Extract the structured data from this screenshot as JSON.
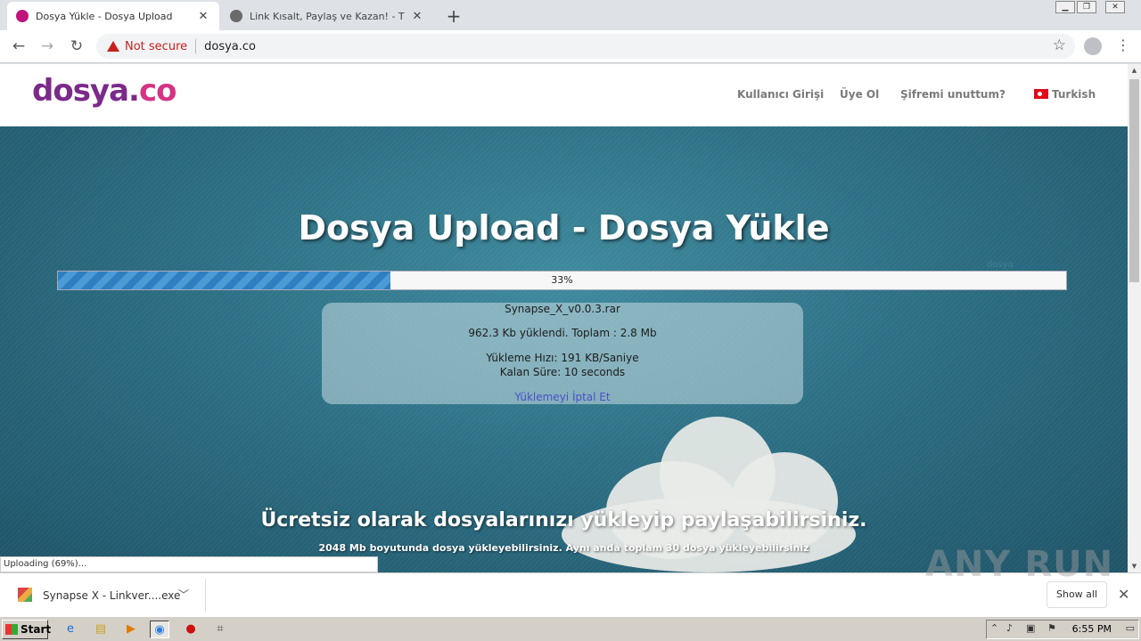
{
  "browser": {
    "tabs": [
      {
        "title": "Dosya Yükle - Dosya Upload",
        "active": true
      },
      {
        "title": "Link Kısalt, Paylaş ve Kazan! - TIK.LA",
        "active": false
      }
    ],
    "security_label": "Not secure",
    "url": "dosya.co"
  },
  "site": {
    "logo_main": "dosya.",
    "logo_accent": "co",
    "nav": {
      "login": "Kullanıcı Girişi",
      "register": "Üye Ol",
      "forgot": "Şifremi unuttum?",
      "language": "Turkish"
    },
    "hero_title": "Dosya Upload - Dosya Yükle",
    "corner_prefix": "dosya",
    "corner_link": "............",
    "upload": {
      "percent_label": "33%",
      "progress_fraction": 0.33,
      "filename": "Synapse_X_v0.0.3.rar",
      "uploaded": "962.3 Kb yüklendi. Toplam : 2.8 Mb",
      "speed": "Yükleme Hızı: 191 KB/Saniye",
      "remaining": "Kalan Süre: 10 seconds",
      "cancel": "Yüklemeyi İptal Et"
    },
    "tagline": "Ücretsiz olarak dosyalarınızı yükleyip paylaşabilirsiniz.",
    "subtext": "2048 Mb boyutunda dosya yükleyebilirsiniz. Aynı anda toplam 30 dosya yükleyebilirsiniz"
  },
  "status_bubble": "Uploading (69%)...",
  "download_shelf": {
    "item_name": "Synapse X - Linkver....exe",
    "show_all": "Show all"
  },
  "watermark": "ANY RUN",
  "taskbar": {
    "start": "Start",
    "clock": "6:55 PM"
  }
}
